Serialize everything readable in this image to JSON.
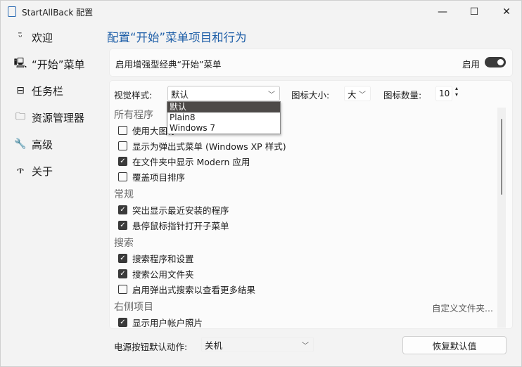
{
  "window": {
    "title": "StartAllBack 配置"
  },
  "sidebar": {
    "items": [
      {
        "label": "欢迎",
        "icon": "smile-icon",
        "glyph": "ᵕ̈"
      },
      {
        "label": "“开始”菜单",
        "icon": "monitor-icon",
        "glyph": "🖳"
      },
      {
        "label": "任务栏",
        "icon": "taskbar-icon",
        "glyph": "⊟"
      },
      {
        "label": "资源管理器",
        "icon": "folder-icon",
        "glyph": "🗀"
      },
      {
        "label": "高级",
        "icon": "wrench-icon",
        "glyph": "🔧"
      },
      {
        "label": "关于",
        "icon": "about-icon",
        "glyph": "ጥ"
      }
    ]
  },
  "main": {
    "heading": "配置“开始”菜单项目和行为",
    "enhanced": {
      "label": "启用增强型经典“开始”菜单",
      "toggle_label": "启用",
      "on": true
    },
    "visual_style": {
      "label": "视觉样式:",
      "value": "默认",
      "options": [
        "默认",
        "Plain8",
        "Windows 7"
      ]
    },
    "icon_size": {
      "label": "图标大小:",
      "value": "大"
    },
    "icon_count": {
      "label": "图标数量:",
      "value": "10"
    },
    "sections": [
      {
        "title": "所有程序",
        "items": [
          {
            "label": "使用大图标",
            "checked": false
          },
          {
            "label": "显示为弹出式菜单 (Windows XP 样式)",
            "checked": false
          },
          {
            "label": "在文件夹中显示 Modern 应用",
            "checked": true
          },
          {
            "label": "覆盖项目排序",
            "checked": false
          }
        ]
      },
      {
        "title": "常规",
        "items": [
          {
            "label": "突出显示最近安装的程序",
            "checked": true
          },
          {
            "label": "悬停鼠标指针打开子菜单",
            "checked": true
          }
        ]
      },
      {
        "title": "搜索",
        "items": [
          {
            "label": "搜索程序和设置",
            "checked": true
          },
          {
            "label": "搜索公用文件夹",
            "checked": true
          },
          {
            "label": "启用弹出式搜索以查看更多结果",
            "checked": false
          }
        ]
      },
      {
        "title": "右侧项目",
        "link": "自定义文件夹...",
        "items": [
          {
            "label": "显示用户帐户照片",
            "checked": true
          }
        ]
      }
    ],
    "power": {
      "label": "电源按钮默认动作:",
      "value": "关机"
    },
    "restore_label": "恢复默认值"
  }
}
